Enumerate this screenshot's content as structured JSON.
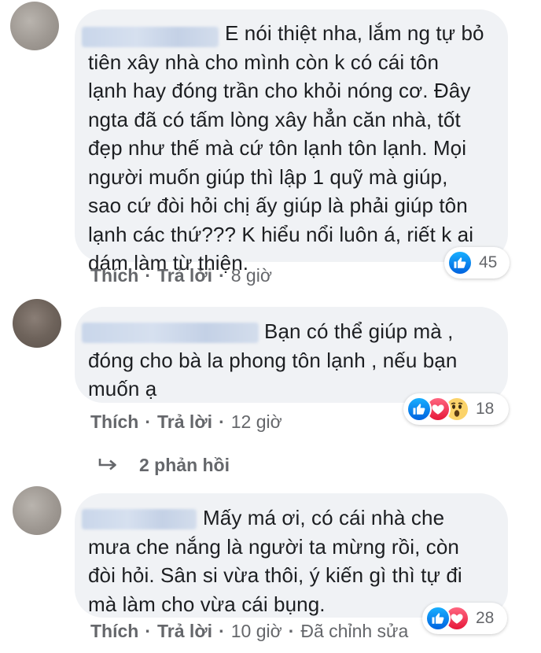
{
  "comments": [
    {
      "text": "E nói thiệt nha, lắm ng tự bỏ\ntiên xây nhà cho mình còn k có cái tôn\nlạnh hay đóng trần cho khỏi nóng cơ. Đây\nngta đã có tấm lòng xây hẳn căn nhà, tốt\nđẹp như thế mà cứ tôn lạnh tôn lạnh. Mọi\nngười muốn giúp thì lập 1 quỹ mà giúp,\nsao cứ đòi hỏi chị ấy giúp là phải giúp tôn\nlạnh các thứ??? K hiểu nổi luôn á, riết k ai\ndám làm từ thiện.",
      "reactions": [
        "like-icon"
      ],
      "reaction_count": "45",
      "like_label": "Thích",
      "reply_label": "Trả lời",
      "time": "8 giờ",
      "separator": "·"
    },
    {
      "text": "Bạn có thể giúp mà ,\nđóng cho bà la phong tôn lạnh , nếu bạn\nmuốn ạ",
      "reactions": [
        "like-icon",
        "love-icon",
        "wow-icon"
      ],
      "reaction_count": "18",
      "like_label": "Thích",
      "reply_label": "Trả lời",
      "time": "12 giờ",
      "separator": "·"
    },
    {
      "text": "Mấy má ơi, có cái nhà che\nmưa che nắng là người ta mừng rồi, còn\nđòi hỏi. Sân si vừa thôi, ý kiến gì thì tự đi\nmà làm cho vừa cái bụng.",
      "reactions": [
        "like-icon",
        "love-icon"
      ],
      "reaction_count": "28",
      "like_label": "Thích",
      "reply_label": "Trả lời",
      "time": "10 giờ",
      "edited": "Đã chỉnh sửa",
      "separator": "·"
    }
  ],
  "view_replies": {
    "label": "2 phản hồi",
    "icon": "reply-arrow-icon"
  },
  "colors": {
    "bubble": "#f0f2f5",
    "text": "#1c1e21",
    "meta": "#65676b",
    "like": "#1877f2",
    "love": "#f33e58",
    "wow": "#fbd36a"
  }
}
